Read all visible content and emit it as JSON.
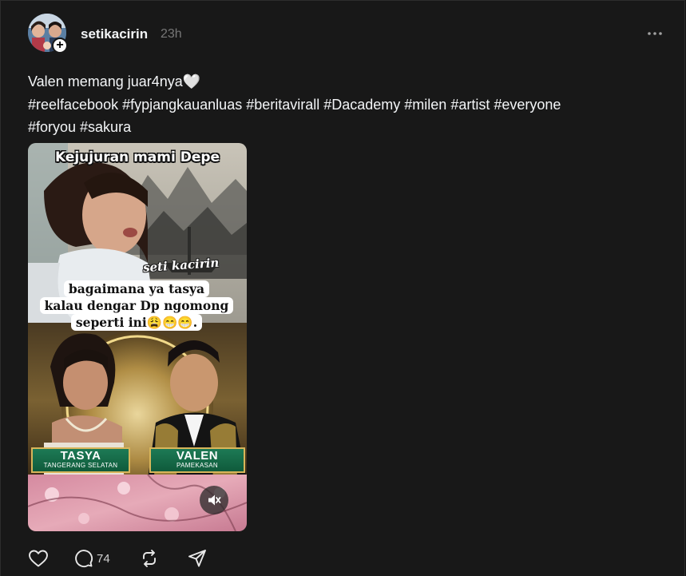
{
  "post": {
    "username": "setikacirin",
    "timestamp": "23h",
    "more_label": "•••",
    "follow_label": "+",
    "caption_lines": [
      "Valen memang juar4nya🤍",
      "#reelfacebook #fypjangkauanluas #beritavirall #Dacademy #milen #artist #everyone",
      "#foryou #sakura"
    ]
  },
  "media": {
    "overlay_title": "Kejujuran mami Depe",
    "watermark": "seti kacirin",
    "bubble_lines": [
      "bagaimana ya tasya",
      "kalau dengar Dp ngomong",
      "seperti ini😩😁😁."
    ],
    "contestants": [
      {
        "name": "TASYA",
        "location": "TANGERANG SELATAN"
      },
      {
        "name": "VALEN",
        "location": "PAMEKASAN"
      }
    ],
    "mute_icon": "speaker-muted-icon"
  },
  "actions": {
    "like_icon": "heart-icon",
    "comment_icon": "comment-icon",
    "comment_count": "74",
    "repost_icon": "repost-icon",
    "share_icon": "share-icon"
  },
  "colors": {
    "background": "#101010",
    "card": "#181818",
    "text": "#f3f5f7",
    "muted": "#777777"
  }
}
